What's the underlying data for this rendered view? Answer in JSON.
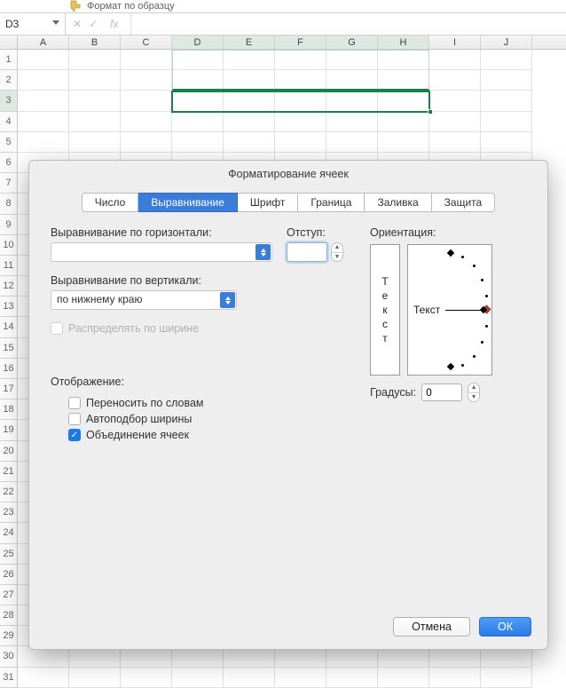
{
  "ribbon": {
    "format_painter_label": "Формат по образцу"
  },
  "formula_bar": {
    "cell_ref": "D3",
    "fx_label": "fx",
    "cancel": "✕",
    "confirm": "✓"
  },
  "grid": {
    "columns": [
      "A",
      "B",
      "C",
      "D",
      "E",
      "F",
      "G",
      "H",
      "I",
      "J"
    ],
    "rows_visible": 31,
    "selection": {
      "start_col": "D",
      "end_col": "H",
      "row": 3
    }
  },
  "dialog": {
    "title": "Форматирование ячеек",
    "tabs": [
      {
        "id": "number",
        "label": "Число",
        "active": false
      },
      {
        "id": "alignment",
        "label": "Выравнивание",
        "active": true
      },
      {
        "id": "font",
        "label": "Шрифт",
        "active": false
      },
      {
        "id": "border",
        "label": "Граница",
        "active": false
      },
      {
        "id": "fill",
        "label": "Заливка",
        "active": false
      },
      {
        "id": "protect",
        "label": "Защита",
        "active": false
      }
    ],
    "h_align_label": "Выравнивание по горизонтали:",
    "h_align_value": "",
    "indent_label": "Отступ:",
    "indent_value": "",
    "v_align_label": "Выравнивание по вертикали:",
    "v_align_value": "по нижнему краю",
    "justify_distributed_label": "Распределять по ширине",
    "justify_distributed_enabled": false,
    "orientation_label": "Ориентация:",
    "orientation_vertical_text": [
      "Т",
      "е",
      "к",
      "с",
      "т"
    ],
    "orientation_horizontal_text": "Текст",
    "degrees_label": "Градусы:",
    "degrees_value": "0",
    "display_section_label": "Отображение:",
    "wrap_text_label": "Переносить по словам",
    "wrap_text_checked": false,
    "shrink_fit_label": "Автоподбор ширины",
    "shrink_fit_checked": false,
    "merge_cells_label": "Объединение ячеек",
    "merge_cells_checked": true,
    "buttons": {
      "cancel": "Отмена",
      "ok": "ОК"
    }
  }
}
